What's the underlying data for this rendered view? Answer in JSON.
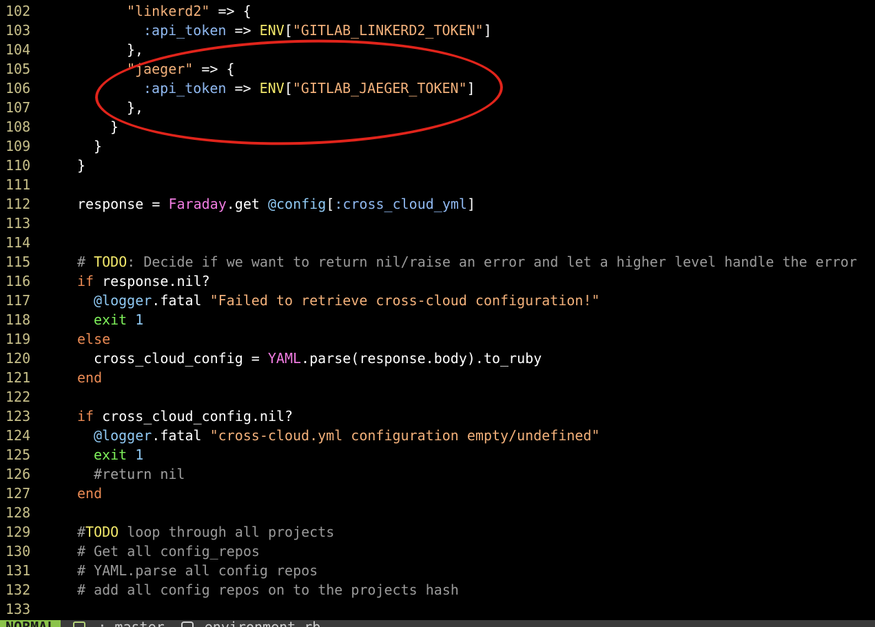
{
  "editor": {
    "lines": [
      {
        "n": "102",
        "indent": 3,
        "tokens": [
          {
            "t": "\"linkerd2\"",
            "c": "str"
          },
          {
            "t": " => {",
            "c": "white"
          }
        ]
      },
      {
        "n": "103",
        "indent": 4,
        "tokens": [
          {
            "t": ":api_token",
            "c": "sym"
          },
          {
            "t": " => ",
            "c": "white"
          },
          {
            "t": "ENV",
            "c": "const2"
          },
          {
            "t": "[",
            "c": "white"
          },
          {
            "t": "\"GITLAB_LINKERD2_TOKEN\"",
            "c": "str"
          },
          {
            "t": "]",
            "c": "white"
          }
        ]
      },
      {
        "n": "104",
        "indent": 3,
        "tokens": [
          {
            "t": "},",
            "c": "white"
          }
        ]
      },
      {
        "n": "105",
        "indent": 3,
        "tokens": [
          {
            "t": "\"jaeger\"",
            "c": "str"
          },
          {
            "t": " => {",
            "c": "white"
          }
        ]
      },
      {
        "n": "106",
        "indent": 4,
        "tokens": [
          {
            "t": ":api_token",
            "c": "sym"
          },
          {
            "t": " => ",
            "c": "white"
          },
          {
            "t": "ENV",
            "c": "const2"
          },
          {
            "t": "[",
            "c": "white"
          },
          {
            "t": "\"GITLAB_JAEGER_TOKEN\"",
            "c": "str"
          },
          {
            "t": "]",
            "c": "white"
          }
        ]
      },
      {
        "n": "107",
        "indent": 3,
        "tokens": [
          {
            "t": "},",
            "c": "white"
          }
        ]
      },
      {
        "n": "108",
        "indent": 2,
        "tokens": [
          {
            "t": "}",
            "c": "white"
          }
        ]
      },
      {
        "n": "109",
        "indent": 1,
        "tokens": [
          {
            "t": "}",
            "c": "white"
          }
        ]
      },
      {
        "n": "110",
        "indent": 0,
        "tokens": [
          {
            "t": "}",
            "c": "white"
          }
        ]
      },
      {
        "n": "111",
        "indent": 0,
        "tokens": []
      },
      {
        "n": "112",
        "indent": 0,
        "tokens": [
          {
            "t": "response = ",
            "c": "white"
          },
          {
            "t": "Faraday",
            "c": "const"
          },
          {
            "t": ".get ",
            "c": "white"
          },
          {
            "t": "@config",
            "c": "ivar"
          },
          {
            "t": "[",
            "c": "white"
          },
          {
            "t": ":cross_cloud_yml",
            "c": "sym"
          },
          {
            "t": "]",
            "c": "white"
          }
        ]
      },
      {
        "n": "113",
        "indent": 0,
        "tokens": []
      },
      {
        "n": "114",
        "indent": 0,
        "tokens": []
      },
      {
        "n": "115",
        "indent": 0,
        "tokens": [
          {
            "t": "# ",
            "c": "comment"
          },
          {
            "t": "TODO",
            "c": "todo"
          },
          {
            "t": ": Decide if we want to return nil/raise an error and let a higher level handle the error",
            "c": "comment"
          }
        ]
      },
      {
        "n": "116",
        "indent": 0,
        "tokens": [
          {
            "t": "if",
            "c": "kw"
          },
          {
            "t": " response.nil?",
            "c": "white"
          }
        ]
      },
      {
        "n": "117",
        "indent": 1,
        "tokens": [
          {
            "t": "@logger",
            "c": "ivar"
          },
          {
            "t": ".fatal ",
            "c": "white"
          },
          {
            "t": "\"Failed to retrieve cross-cloud configuration!\"",
            "c": "str"
          }
        ]
      },
      {
        "n": "118",
        "indent": 1,
        "tokens": [
          {
            "t": "exit",
            "c": "green"
          },
          {
            "t": " ",
            "c": "white"
          },
          {
            "t": "1",
            "c": "num"
          }
        ]
      },
      {
        "n": "119",
        "indent": 0,
        "tokens": [
          {
            "t": "else",
            "c": "kw"
          }
        ]
      },
      {
        "n": "120",
        "indent": 1,
        "tokens": [
          {
            "t": "cross_cloud_config = ",
            "c": "white"
          },
          {
            "t": "YAML",
            "c": "const"
          },
          {
            "t": ".parse(response.body).to_ruby",
            "c": "white"
          }
        ]
      },
      {
        "n": "121",
        "indent": 0,
        "tokens": [
          {
            "t": "end",
            "c": "kw"
          }
        ]
      },
      {
        "n": "122",
        "indent": 0,
        "tokens": []
      },
      {
        "n": "123",
        "indent": 0,
        "tokens": [
          {
            "t": "if",
            "c": "kw"
          },
          {
            "t": " cross_cloud_config.nil?",
            "c": "white"
          }
        ]
      },
      {
        "n": "124",
        "indent": 1,
        "tokens": [
          {
            "t": "@logger",
            "c": "ivar"
          },
          {
            "t": ".fatal ",
            "c": "white"
          },
          {
            "t": "\"cross-cloud.yml configuration empty/undefined\"",
            "c": "str"
          }
        ]
      },
      {
        "n": "125",
        "indent": 1,
        "tokens": [
          {
            "t": "exit",
            "c": "green"
          },
          {
            "t": " ",
            "c": "white"
          },
          {
            "t": "1",
            "c": "num"
          }
        ]
      },
      {
        "n": "126",
        "indent": 1,
        "tokens": [
          {
            "t": "#return nil",
            "c": "mut"
          }
        ]
      },
      {
        "n": "127",
        "indent": 0,
        "tokens": [
          {
            "t": "end",
            "c": "kw"
          }
        ]
      },
      {
        "n": "128",
        "indent": 0,
        "tokens": []
      },
      {
        "n": "129",
        "indent": 0,
        "tokens": [
          {
            "t": "#",
            "c": "comment"
          },
          {
            "t": "TODO",
            "c": "todo"
          },
          {
            "t": " loop through all projects",
            "c": "comment"
          }
        ]
      },
      {
        "n": "130",
        "indent": 0,
        "tokens": [
          {
            "t": "# Get all config_repos",
            "c": "comment"
          }
        ]
      },
      {
        "n": "131",
        "indent": 0,
        "tokens": [
          {
            "t": "# YAML.parse all config repos",
            "c": "comment"
          }
        ]
      },
      {
        "n": "132",
        "indent": 0,
        "tokens": [
          {
            "t": "# add all config repos on to the projects hash",
            "c": "comment"
          }
        ]
      },
      {
        "n": "133",
        "indent": 0,
        "tokens": []
      }
    ]
  },
  "statusbar": {
    "mode": "NORMAL",
    "branch": ": master",
    "filename": "environment.rb"
  },
  "colors": {
    "background": "#000000",
    "annotation": "#e0241b",
    "mode_bg": "#8bc34a"
  }
}
